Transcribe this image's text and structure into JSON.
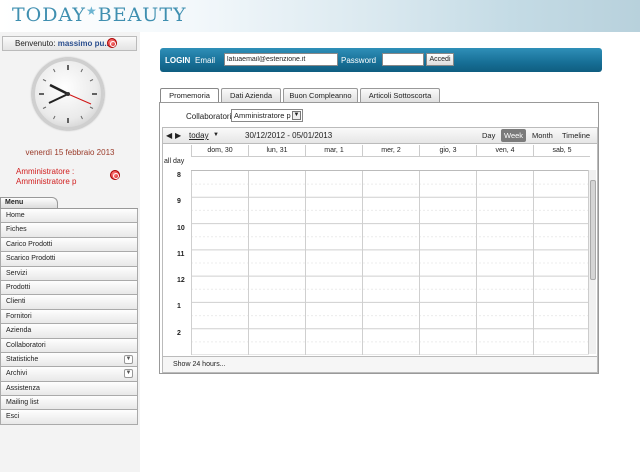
{
  "app": {
    "logo_left": "TODAY",
    "logo_star": "★",
    "logo_right": "BEAUTY"
  },
  "sidebar": {
    "welcome_prefix": "Benvenuto:",
    "welcome_user": "massimo pu...",
    "date": "venerdì 15 febbraio 2013",
    "admin_line1": "Amministratore :",
    "admin_line2": "Amministratore p",
    "menu_tab": "Menu",
    "menu": [
      {
        "label": "Home",
        "chevron": false
      },
      {
        "label": "Fiches",
        "chevron": false
      },
      {
        "label": "Carico Prodotti",
        "chevron": false
      },
      {
        "label": "Scarico Prodotti",
        "chevron": false
      },
      {
        "label": "Servizi",
        "chevron": false
      },
      {
        "label": "Prodotti",
        "chevron": false
      },
      {
        "label": "Clienti",
        "chevron": false
      },
      {
        "label": "Fornitori",
        "chevron": false
      },
      {
        "label": "Azienda",
        "chevron": false
      },
      {
        "label": "Collaboratori",
        "chevron": false
      },
      {
        "label": "Statistiche",
        "chevron": true
      },
      {
        "label": "Archivi",
        "chevron": true
      },
      {
        "label": "Assistenza",
        "chevron": false
      },
      {
        "label": "Mailing list",
        "chevron": false
      },
      {
        "label": "Esci",
        "chevron": false
      }
    ]
  },
  "login": {
    "title": "LOGIN",
    "email_label": "Email",
    "email_value": "latuaemail@estenzione.it",
    "password_label": "Password",
    "password_value": "",
    "button": "Accedi"
  },
  "tabs": [
    "Promemoria",
    "Dati Azienda",
    "Buon Compleanno",
    "Articoli Sottoscorta"
  ],
  "calendar": {
    "collaboratori_label": "Collaboratori",
    "collaboratori_value": "Amministratore p",
    "today": "today",
    "today_caret": "▼",
    "range": "30/12/2012 - 05/01/2013",
    "views": [
      "Day",
      "Week",
      "Month",
      "Timeline"
    ],
    "active_view": "Week",
    "days": [
      "dom, 30",
      "lun, 31",
      "mar, 1",
      "mer, 2",
      "gio, 3",
      "ven, 4",
      "sab, 5"
    ],
    "all_day": "all day",
    "hours": [
      "8",
      "9",
      "10",
      "11",
      "12",
      "1",
      "2"
    ],
    "show24": "Show 24 hours..."
  },
  "colors": {
    "accent": "#176f96",
    "admin_red": "#d12020",
    "date_brown": "#9a3b2a"
  }
}
